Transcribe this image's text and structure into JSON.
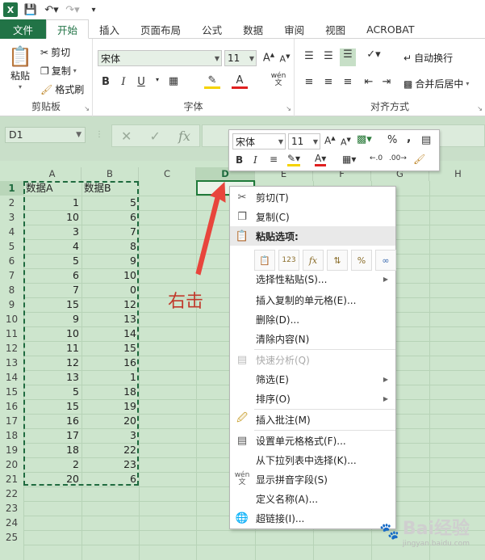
{
  "qat": {
    "logo": "X"
  },
  "tabs": [
    "文件",
    "开始",
    "插入",
    "页面布局",
    "公式",
    "数据",
    "审阅",
    "视图",
    "ACROBAT"
  ],
  "ribbon": {
    "clipboard": {
      "paste": "粘贴",
      "cut": "剪切",
      "copy": "复制",
      "format_painter": "格式刷",
      "label": "剪贴板"
    },
    "font": {
      "name": "宋体",
      "size": "11",
      "bold": "B",
      "italic": "I",
      "underline": "U",
      "wen": "wén",
      "label": "字体"
    },
    "align": {
      "wrap": "自动换行",
      "merge": "合并后居中",
      "label": "对齐方式"
    }
  },
  "formula_bar": {
    "name_box": "D1",
    "fx": "fx"
  },
  "mini_toolbar": {
    "font": "宋体",
    "size": "11",
    "percent": "%",
    "comma": ",",
    "bold": "B",
    "italic": "I"
  },
  "columns": [
    "A",
    "B",
    "C",
    "D",
    "E",
    "F",
    "G",
    "H"
  ],
  "rows": [
    "1",
    "2",
    "3",
    "4",
    "5",
    "6",
    "7",
    "8",
    "9",
    "10",
    "11",
    "12",
    "13",
    "14",
    "15",
    "16",
    "17",
    "18",
    "19",
    "20",
    "21",
    "22",
    "23",
    "24",
    "25"
  ],
  "header_row": {
    "a": "数据A",
    "b": "数据B"
  },
  "data_a": [
    "1",
    "10",
    "3",
    "4",
    "5",
    "6",
    "7",
    "15",
    "9",
    "10",
    "11",
    "12",
    "13",
    "5",
    "15",
    "16",
    "17",
    "18",
    "2",
    "20"
  ],
  "data_b": [
    "5",
    "6",
    "7",
    "8",
    "9",
    "10",
    "0",
    "12",
    "13",
    "14",
    "15",
    "16",
    "1",
    "18",
    "19",
    "20",
    "3",
    "22",
    "23",
    "6"
  ],
  "context_menu": {
    "cut": "剪切(T)",
    "copy": "复制(C)",
    "paste_options": "粘贴选项:",
    "paste_special": "选择性粘贴(S)...",
    "insert_copied": "插入复制的单元格(E)...",
    "delete": "删除(D)...",
    "clear": "清除内容(N)",
    "quick_analysis": "快速分析(Q)",
    "filter": "筛选(E)",
    "sort": "排序(O)",
    "insert_comment": "插入批注(M)",
    "format_cells": "设置单元格格式(F)...",
    "pick_from_list": "从下拉列表中选择(K)...",
    "phonetic": "显示拼音字段(S)",
    "define_name": "定义名称(A)...",
    "hyperlink": "超链接(I)..."
  },
  "annotation": "右击",
  "watermark": {
    "text": "Bai经验",
    "sub": "jingyan.baidu.com"
  },
  "colors": {
    "excel_green": "#217346",
    "grid_bg": "#cde5cd",
    "annotation_red": "#c0392b"
  }
}
